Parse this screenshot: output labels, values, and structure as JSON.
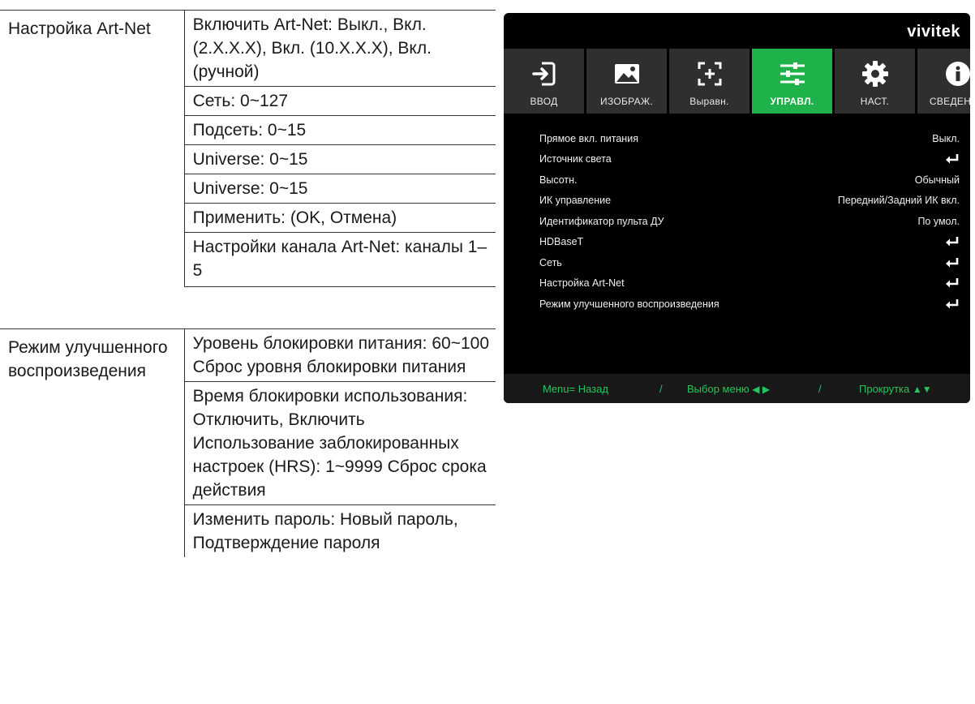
{
  "doc": {
    "art_net": {
      "label": "Настройка Art-Net",
      "values": [
        "Включить Art-Net: Выкл., Вкл. (2.X.X.X), Вкл. (10.X.X.X), Вкл. (ручной)",
        "Сеть: 0~127",
        "Подсеть: 0~15",
        "Universe: 0~15",
        "Universe: 0~15",
        "Применить: (OK, Отмена)",
        "Настройки канала Art-Net: каналы 1–5"
      ]
    },
    "enhanced": {
      "label": "Режим улучшенного воспроизведения",
      "values": [
        "Уровень блокировки питания: 60~100 Сброс уровня блокировки питания",
        "Время блокировки использования: Отключить, Включить Использование заблокированных настроек (HRS): 1~9999 Сброс срока действия",
        "Изменить пароль: Новый пароль, Подтверждение пароля"
      ]
    }
  },
  "osd": {
    "brand": "vivitek",
    "tabs": [
      {
        "label": "ВВОД",
        "icon": "input-icon"
      },
      {
        "label": "ИЗОБРАЖ.",
        "icon": "image-icon"
      },
      {
        "label": "Выравн.",
        "icon": "alignment-icon"
      },
      {
        "label": "УПРАВЛ.",
        "icon": "sliders-icon",
        "active": true
      },
      {
        "label": "НАСТ.",
        "icon": "gear-icon"
      },
      {
        "label": "СВЕДЕНИЯ",
        "icon": "info-icon"
      }
    ],
    "menu": [
      {
        "label": "Прямое вкл. питания",
        "value": "Выкл."
      },
      {
        "label": "Источник света",
        "value": ""
      },
      {
        "label": "Высотн.",
        "value": "Обычный"
      },
      {
        "label": "ИК управление",
        "value": "Передний/Задний ИК вкл."
      },
      {
        "label": "Идентификатор пульта ДУ",
        "value": "По умол."
      },
      {
        "label": "HDBaseT",
        "value": ""
      },
      {
        "label": "Сеть",
        "value": ""
      },
      {
        "label": "Настройка Art-Net",
        "value": ""
      },
      {
        "label": "Режим улучшенного воспроизведения",
        "value": ""
      }
    ],
    "footer": {
      "back": "Menu= Назад",
      "separator": "/",
      "select": "Выбор меню",
      "select_arrows": "◀ ▶",
      "scroll": "Прокрутка",
      "scroll_arrows": "▲▼"
    },
    "colors": {
      "accent": "#1fb14a",
      "footer_text": "#26c55b",
      "tab_bg": "#2f2f2f"
    }
  }
}
